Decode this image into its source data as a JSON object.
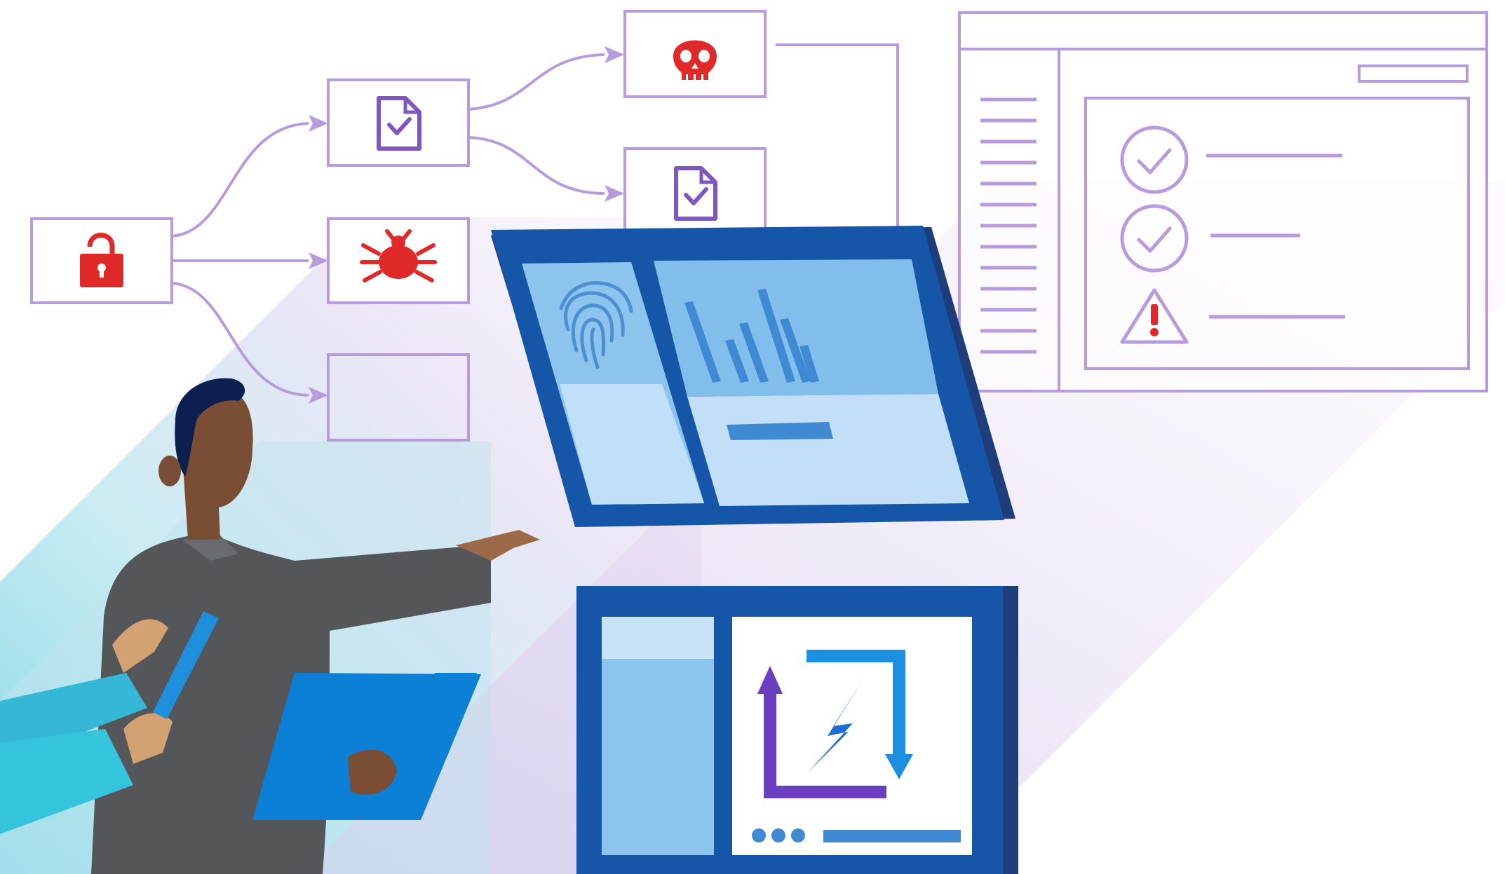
{
  "scene": {
    "type": "illustration",
    "theme": "threat-detection-and-response",
    "colors": {
      "outline_purple": "#B79BDC",
      "outline_purple_dark": "#7E57C2",
      "threat_red": "#E02A2A",
      "screen_blue_dark": "#1656A8",
      "screen_blue_mid": "#5FA6E6",
      "screen_blue_light": "#BFE0F8",
      "teal_glow": "#7ED8E6",
      "lavender_glow": "#E2D6F2",
      "accent_blue": "#0C7FD6"
    },
    "icons": {
      "unlocked_padlock": "lock-open-icon",
      "document_check": "document-check-icon",
      "bug": "bug-icon",
      "skull": "skull-icon",
      "fingerprint": "fingerprint-icon",
      "bar_chart": "bar-chart-icon",
      "check_circle": "check-circle-icon",
      "warning": "warning-icon",
      "sync_arrows": "sync-arrows-icon",
      "lightning": "lightning-icon"
    }
  }
}
